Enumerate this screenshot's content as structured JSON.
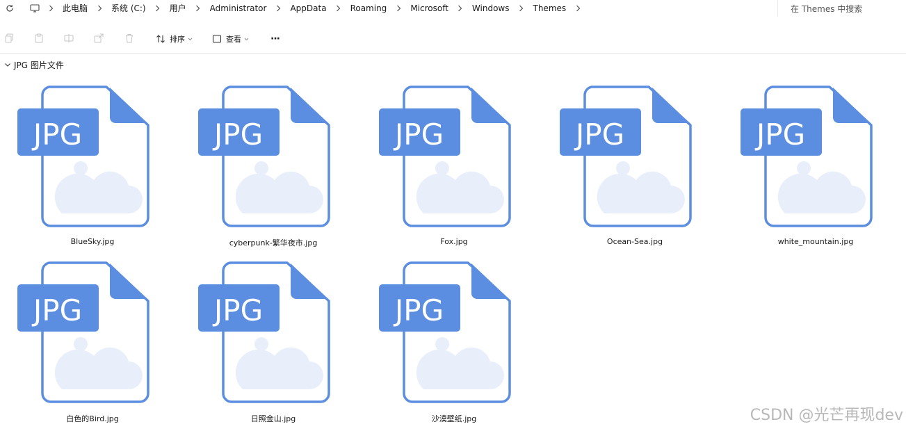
{
  "address_bar": {
    "breadcrumb": [
      "此电脑",
      "系统 (C:)",
      "用户",
      "Administrator",
      "AppData",
      "Roaming",
      "Microsoft",
      "Windows",
      "Themes"
    ],
    "search_placeholder": "在 Themes 中搜索"
  },
  "toolbar": {
    "sort_label": "排序",
    "view_label": "查看",
    "more_label": "···"
  },
  "group": {
    "title": "JPG 图片文件"
  },
  "files": [
    {
      "name": "BlueSky.jpg",
      "badge": "JPG"
    },
    {
      "name": "cyberpunk-繁华夜市.jpg",
      "badge": "JPG"
    },
    {
      "name": "Fox.jpg",
      "badge": "JPG"
    },
    {
      "name": "Ocean-Sea.jpg",
      "badge": "JPG"
    },
    {
      "name": "white_mountain.jpg",
      "badge": "JPG"
    },
    {
      "name": "白色的Bird.jpg",
      "badge": "JPG"
    },
    {
      "name": "日照金山.jpg",
      "badge": "JPG"
    },
    {
      "name": "沙漠壁纸.jpg",
      "badge": "JPG"
    }
  ],
  "colors": {
    "file_icon_stroke": "#5b8ee0",
    "file_icon_badge": "#5b8ee0",
    "file_icon_faint": "#e8effb"
  },
  "watermark": "CSDN @光芒再现dev"
}
